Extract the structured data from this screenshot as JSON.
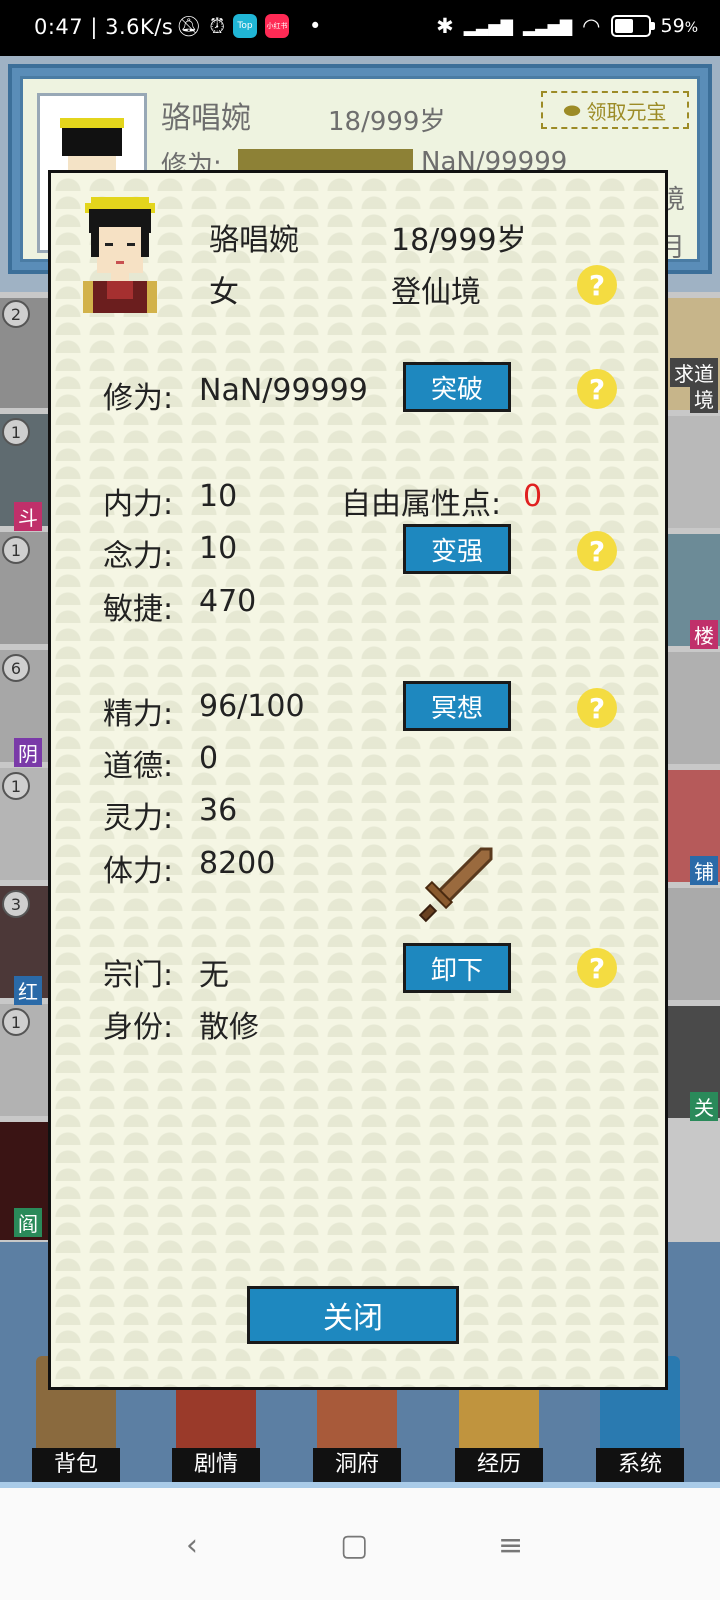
{
  "status_bar": {
    "time": "0:47 | 3.6K/s",
    "app1": "Top",
    "app2": "小红书",
    "dot": "•",
    "battery": "59",
    "battery_unit": "%",
    "battery_level": 0.59
  },
  "background": {
    "name": "骆唱婉",
    "age": "18/999岁",
    "claim_button": "领取元宝",
    "cultivation_label": "修为:",
    "cultivation_value": "NaN/99999",
    "side_texts": [
      "境",
      "月"
    ],
    "list_badges": [
      "2",
      "1",
      "1",
      "6",
      "1",
      "3",
      "1"
    ],
    "list_tags_left": [
      "斗",
      "阴",
      "红",
      "阎"
    ],
    "list_tags_right": [
      "求道",
      "境",
      "楼",
      "铺",
      "关"
    ],
    "nav": [
      "背包",
      "剧情",
      "洞府",
      "经历",
      "系统"
    ]
  },
  "dialog": {
    "name": "骆唱婉",
    "age": "18/999岁",
    "gender": "女",
    "realm": "登仙境",
    "cultivation_label": "修为:",
    "cultivation_value": "NaN/99999",
    "breakthrough_button": "突破",
    "inner_power_label": "内力:",
    "inner_power_value": "10",
    "free_points_label": "自由属性点:",
    "free_points_value": "0",
    "mind_power_label": "念力:",
    "mind_power_value": "10",
    "strengthen_button": "变强",
    "agility_label": "敏捷:",
    "agility_value": "470",
    "energy_label": "精力:",
    "energy_value": "96/100",
    "meditate_button": "冥想",
    "morality_label": "道德:",
    "morality_value": "0",
    "spirit_label": "灵力:",
    "spirit_value": "36",
    "stamina_label": "体力:",
    "stamina_value": "8200",
    "sect_label": "宗门:",
    "sect_value": "无",
    "unequip_button": "卸下",
    "identity_label": "身份:",
    "identity_value": "散修",
    "close_button": "关闭",
    "help_glyph": "?"
  },
  "system_nav": {
    "back": "‹",
    "home": "▢",
    "menu": "≡"
  },
  "colors": {
    "button_blue": "#1e88bf",
    "help_yellow": "#f4dc41",
    "dialog_bg": "#f5f6e4",
    "free_points_red": "#e02020"
  }
}
